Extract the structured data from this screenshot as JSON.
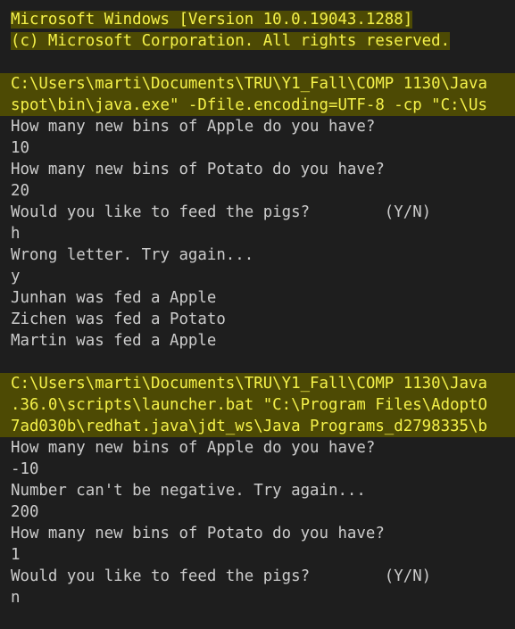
{
  "terminal": {
    "blocks": [
      {
        "lines": [
          {
            "text": "Microsoft Windows [Version 10.0.19043.1288]",
            "highlight": true,
            "full": false
          },
          {
            "text": "(c) Microsoft Corporation. All rights reserved.",
            "highlight": true,
            "full": false
          }
        ]
      },
      {
        "lines": [
          {
            "text": "C:\\Users\\marti\\Documents\\TRU\\Y1_Fall\\COMP 1130\\Java",
            "highlight": true,
            "full": true
          },
          {
            "text": "spot\\bin\\java.exe\" -Dfile.encoding=UTF-8 -cp \"C:\\Us",
            "highlight": true,
            "full": true
          },
          {
            "text": "How many new bins of Apple do you have?",
            "highlight": false
          },
          {
            "text": "10",
            "highlight": false
          },
          {
            "text": "How many new bins of Potato do you have?",
            "highlight": false
          },
          {
            "text": "20",
            "highlight": false
          },
          {
            "text": "Would you like to feed the pigs?        (Y/N)",
            "highlight": false
          },
          {
            "text": "h",
            "highlight": false
          },
          {
            "text": "Wrong letter. Try again...",
            "highlight": false
          },
          {
            "text": "y",
            "highlight": false
          },
          {
            "text": "Junhan was fed a Apple",
            "highlight": false
          },
          {
            "text": "Zichen was fed a Potato",
            "highlight": false
          },
          {
            "text": "Martin was fed a Apple",
            "highlight": false
          }
        ]
      },
      {
        "lines": [
          {
            "text": "C:\\Users\\marti\\Documents\\TRU\\Y1_Fall\\COMP 1130\\Java",
            "highlight": true,
            "full": true
          },
          {
            "text": ".36.0\\scripts\\launcher.bat \"C:\\Program Files\\AdoptO",
            "highlight": true,
            "full": true
          },
          {
            "text": "7ad030b\\redhat.java\\jdt_ws\\Java Programs_d2798335\\b",
            "highlight": true,
            "full": true
          },
          {
            "text": "How many new bins of Apple do you have?",
            "highlight": false
          },
          {
            "text": "-10",
            "highlight": false
          },
          {
            "text": "Number can't be negative. Try again...",
            "highlight": false
          },
          {
            "text": "200",
            "highlight": false
          },
          {
            "text": "How many new bins of Potato do you have?",
            "highlight": false
          },
          {
            "text": "1",
            "highlight": false
          },
          {
            "text": "Would you like to feed the pigs?        (Y/N)",
            "highlight": false
          },
          {
            "text": "n",
            "highlight": false
          }
        ]
      }
    ],
    "colors": {
      "background": "#1e1e1e",
      "text": "#cccccc",
      "highlight_bg": "#4d4a04",
      "highlight_text": "#f5f24a"
    }
  }
}
